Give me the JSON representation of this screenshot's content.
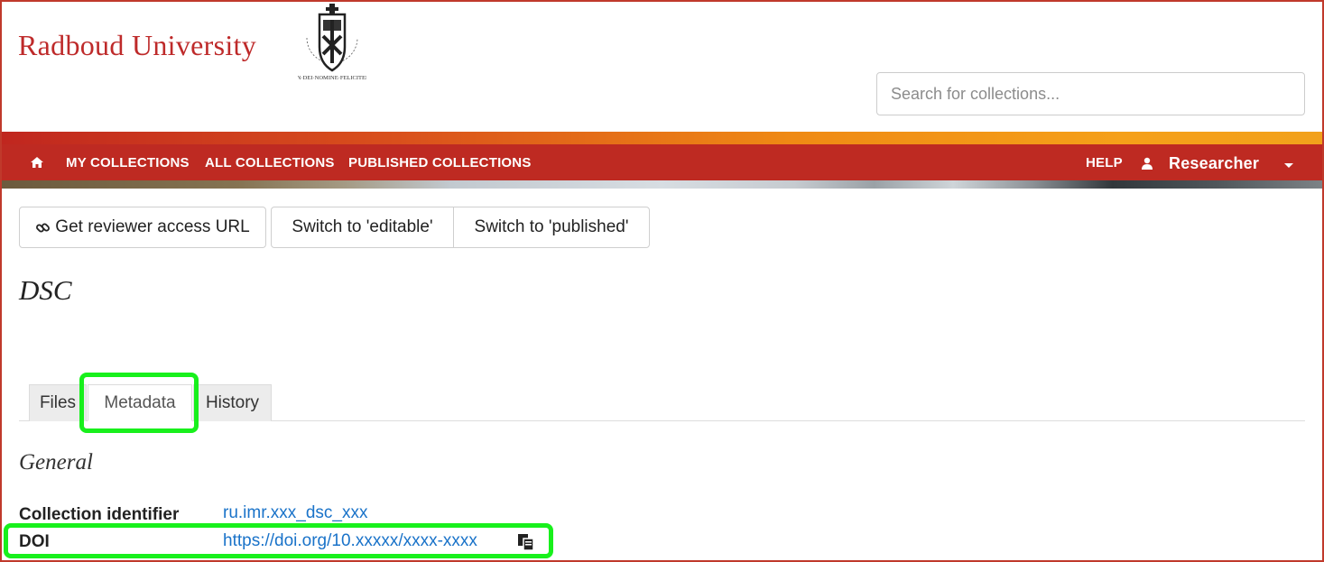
{
  "header": {
    "university_name": "Radboud University",
    "seal_motto": "IN DEI NOMINE FELICITER",
    "search_placeholder": "Search for collections..."
  },
  "nav": {
    "items": [
      "MY COLLECTIONS",
      "ALL COLLECTIONS",
      "PUBLISHED COLLECTIONS"
    ],
    "help": "HELP",
    "user": "Researcher",
    "icons": [
      "home-icon",
      "user-icon",
      "caret-down-icon"
    ]
  },
  "toolbar": {
    "reviewer_button": "Get reviewer access URL",
    "editable_button": "Switch to 'editable'",
    "published_button": "Switch to 'published'"
  },
  "collection": {
    "title": "DSC"
  },
  "tabs": [
    {
      "label": "Files",
      "active": false
    },
    {
      "label": "Metadata",
      "active": true
    },
    {
      "label": "History",
      "active": false
    }
  ],
  "metadata": {
    "section_title": "General",
    "rows": [
      {
        "label": "Collection identifier",
        "value": "ru.imr.xxx_dsc_xxx"
      },
      {
        "label": "DOI",
        "value": "https://doi.org/10.xxxxx/xxxx-xxxx"
      }
    ]
  },
  "colors": {
    "brand_red": "#be2a22",
    "highlight_green": "#18f01c",
    "link_blue": "#1a73c9"
  }
}
